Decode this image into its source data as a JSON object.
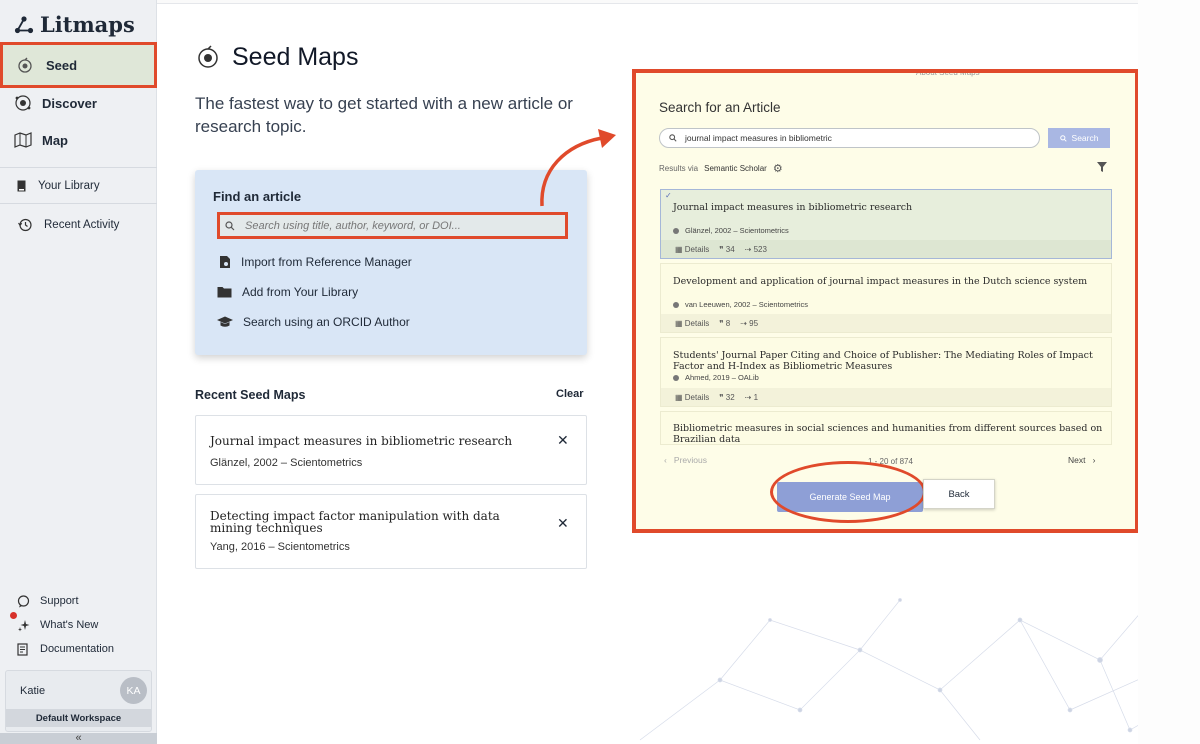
{
  "brand": {
    "name": "Litmaps"
  },
  "sidebar": {
    "nav": [
      {
        "label": "Seed",
        "icon": "seed-icon"
      },
      {
        "label": "Discover",
        "icon": "discover-icon"
      },
      {
        "label": "Map",
        "icon": "map-icon"
      }
    ],
    "library": {
      "label": "Your Library"
    },
    "recent": {
      "label": "Recent Activity"
    },
    "bottom": [
      {
        "label": "Support"
      },
      {
        "label": "What's New"
      },
      {
        "label": "Documentation"
      }
    ],
    "user": {
      "name": "Katie",
      "initials": "KA",
      "workspace": "Default Workspace"
    },
    "collapse": "«"
  },
  "main": {
    "title": "Seed Maps",
    "subtitle": "The fastest way to get started with a new article or research topic.",
    "find": {
      "heading": "Find an article",
      "placeholder": "Search using title, author, keyword, or DOI...",
      "options": [
        {
          "label": "Import from Reference Manager"
        },
        {
          "label": "Add from Your Library"
        },
        {
          "label": "Search using an ORCID Author"
        }
      ]
    },
    "recent": {
      "heading": "Recent Seed Maps",
      "clear": "Clear",
      "items": [
        {
          "title": "Journal impact measures in bibliometric research",
          "meta": "Glänzel, 2002 – Scientometrics"
        },
        {
          "title": "Detecting impact factor manipulation with data mining techniques",
          "meta": "Yang, 2016 – Scientometrics"
        }
      ]
    }
  },
  "panel": {
    "heading": "Search for an Article",
    "query": "journal impact measures in bibliometric",
    "search_btn": "Search",
    "results_via": "Results via",
    "source": "Semantic Scholar",
    "results": [
      {
        "title": "Journal impact measures in bibliometric research",
        "meta": "Glänzel, 2002 – Scientometrics",
        "details": "Details",
        "cites": "34",
        "refs": "523"
      },
      {
        "title": "Development and application of journal impact measures in the Dutch science system",
        "meta": "van Leeuwen, 2002 – Scientometrics",
        "details": "Details",
        "cites": "8",
        "refs": "95"
      },
      {
        "title": "Students' Journal Paper Citing and Choice of Publisher: The Mediating Roles of Impact Factor and H-Index as Bibliometric Measures",
        "meta": "Ahmed, 2019 – OALib",
        "details": "Details",
        "cites": "32",
        "refs": "1"
      },
      {
        "title": "Bibliometric measures in social sciences and humanities from different sources based on Brazilian data"
      }
    ],
    "prev": "Previous",
    "page_info": "1 - 20 of 874",
    "next": "Next",
    "generate": "Generate Seed Map",
    "back": "Back",
    "partial_top": "About Seed Maps"
  },
  "colors": {
    "highlight": "#e04a2b",
    "seed_active": "#dfe7d8",
    "accent": "#8e9fd6"
  }
}
